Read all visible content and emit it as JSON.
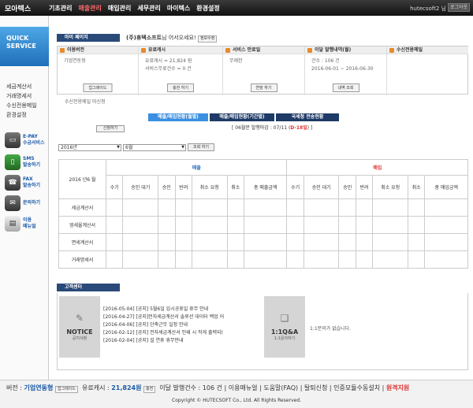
{
  "top": {
    "logo": "모아텍스",
    "nav": [
      "기초관리",
      "매출관리",
      "매입관리",
      "세무관리",
      "마이텍스",
      "환경설정"
    ],
    "user": "hutecsoft2 님",
    "logout": "로그아웃"
  },
  "sidebar": {
    "quick": "QUICK",
    "service": "SERVICE",
    "menu": [
      "세금계산서",
      "거래명세서",
      "수신전용메일",
      "환경설정"
    ],
    "buttons": [
      {
        "label": "E-PAY",
        "sub": "수금서비스"
      },
      {
        "label": "SMS",
        "sub": "발송하기"
      },
      {
        "label": "FAX",
        "sub": "발송하기"
      },
      {
        "label": "문의하기",
        "sub": ""
      },
      {
        "label": "이용",
        "sub": "매뉴얼"
      }
    ]
  },
  "mypage": {
    "title": "마이 페이지",
    "greet_name": "(주)휴텍소프트",
    "greet_rest": "님 어서오세요!",
    "edit_btn": "정보수정",
    "cols": [
      {
        "title": "이용버전",
        "lines": [
          "기업연동형"
        ],
        "button": "업그레이드"
      },
      {
        "title": "유료캐시",
        "lines": [
          "유료캐시 = 21,824 원",
          "서비스무료건수 = 0 건"
        ],
        "button": "충전 하기"
      },
      {
        "title": "서비스 만료일",
        "lines": [
          "무제한"
        ],
        "button": "연장 하기"
      },
      {
        "title": "이달 발행내역(월)",
        "lines": [
          "건수 : 106 건",
          "2016-06-01 ~ 2016-06-30"
        ],
        "button": "내역 조회"
      },
      {
        "title": "수신전용메일",
        "lines": [],
        "button": ""
      }
    ],
    "email_note": "수신전용메일 미신청",
    "apply_btn": "신청하기"
  },
  "tabs": [
    "매출/매입현황(월별)",
    "매출/매입현황(기간별)",
    "국세청 전송현황"
  ],
  "deadline": {
    "prefix": "[ 06월분 발행마감 : 07/11 (",
    "dday": "D-18일",
    "suffix": ") ]"
  },
  "filter": {
    "year": "2016년",
    "month": "6월",
    "query_btn": "조회 하기"
  },
  "grid": {
    "period": "2016 년6 월",
    "sales": "매출",
    "buy": "매입",
    "cols": [
      "수기",
      "승인 대기",
      "승인",
      "반려",
      "취소 요청",
      "취소",
      "총 매출금액"
    ],
    "cols_buy": [
      "수기",
      "승인 대기",
      "승인",
      "반려",
      "취소 요청",
      "취소",
      "총 매입금액"
    ],
    "rows": [
      "세금계산서",
      "영세율계산서",
      "면세계산서",
      "거래명세서"
    ]
  },
  "cs": {
    "title": "고객센터",
    "notice": "NOTICE",
    "notice_sub": "공지사항",
    "items": [
      "[2016-05-04] [공지] 5월6일 임시공휴일 휴무 안내",
      "[2016-04-27] [공지]전자세금계산서 솔루션 데이터 백업 어",
      "[2016-04-06] [공지] 단축근무 일정 안내",
      "[2016-02-12] [공지] 전자세금계산서 인쇄 시 작게 출력되(",
      "[2016-02-04] [공지] 설 연휴 휴무안내"
    ],
    "qa": "1:1Q&A",
    "qa_sub": "1:1문의하기",
    "qa_text": "1:1문의가 없습니다."
  },
  "footer": {
    "version_label": "버전 : ",
    "version": "기업연동형",
    "upgrade": "업그레이드",
    "cash_label": "유료캐시 : ",
    "cash": "21,824원",
    "charge": "충전",
    "monthly": "이달 발행건수 : 106 건",
    "links": [
      "이용매뉴얼",
      "도움말(FAQ)",
      "탈퇴신청",
      "인증모듈수동설치"
    ],
    "remote": "원격지원",
    "copyright": "Copyright © HUTECSOFT Co., Ltd. All Rights Reserved."
  }
}
